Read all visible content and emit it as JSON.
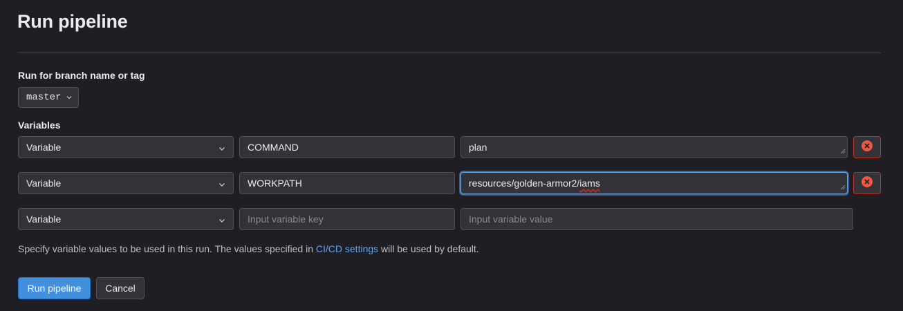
{
  "page": {
    "title": "Run pipeline"
  },
  "branch": {
    "label": "Run for branch name or tag",
    "selected": "master"
  },
  "variables": {
    "label": "Variables",
    "rows": [
      {
        "type": "Variable",
        "key": "COMMAND",
        "value": "plan",
        "removable": true
      },
      {
        "type": "Variable",
        "key": "WORKPATH",
        "value_prefix": "resources/golden-armor2/",
        "value_flagged": "iams",
        "removable": true,
        "focused": true
      },
      {
        "type": "Variable",
        "key": "",
        "value": "",
        "key_placeholder": "Input variable key",
        "value_placeholder": "Input variable value",
        "removable": false
      }
    ]
  },
  "help": {
    "text_before": "Specify variable values to be used in this run. The values specified in ",
    "link": "CI/CD settings",
    "text_after": " will be used by default."
  },
  "actions": {
    "run_label": "Run pipeline",
    "cancel_label": "Cancel"
  },
  "colors": {
    "background": "#1f1e24",
    "primary": "#428fdc",
    "danger": "#dd2b0e",
    "link": "#63a6e9"
  },
  "icons": {
    "chevron": "chevron-down-icon",
    "remove": "clear-icon"
  }
}
